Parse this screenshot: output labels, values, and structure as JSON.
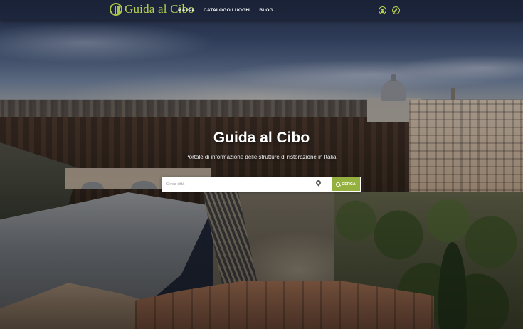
{
  "app": {
    "logo_text": "Guida al Cibo",
    "brand_color": "#b7cf52",
    "accent_button_color": "#94b03f"
  },
  "nav": {
    "links": [
      {
        "label": "MAPPA"
      },
      {
        "label": "CATALOGO LUOGHI"
      },
      {
        "label": "BLOG"
      }
    ],
    "icons": [
      "user-icon",
      "compass-icon"
    ]
  },
  "hero": {
    "title": "Guida al Cibo",
    "subtitle": "Portale di informazione delle strutture di ristorazione in Italia."
  },
  "search": {
    "placeholder": "Cerca città",
    "value": "",
    "location_icon": "map-pin-icon",
    "button_label": "CERCA",
    "button_icon": "search-icon"
  }
}
